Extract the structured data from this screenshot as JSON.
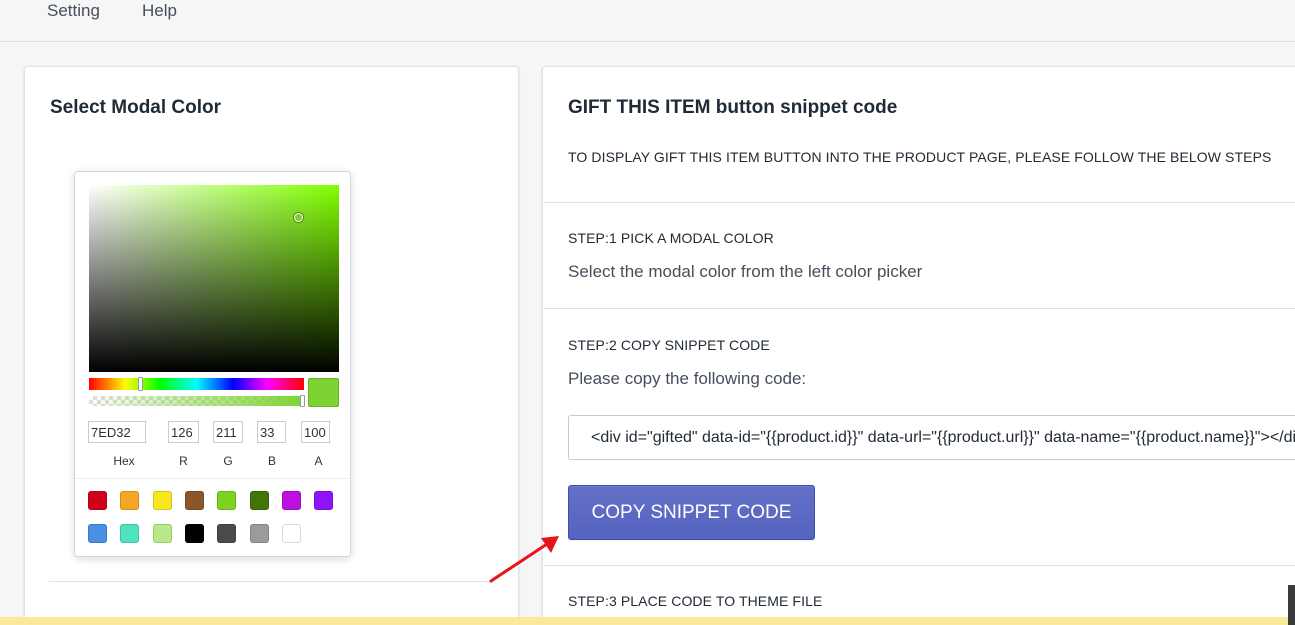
{
  "menu": {
    "items": [
      {
        "label": "Setting"
      },
      {
        "label": "Help"
      }
    ]
  },
  "left_card": {
    "title": "Select Modal Color"
  },
  "color_picker": {
    "current_color": "#7ED332",
    "hue_color": "#80ff00",
    "fields": {
      "hex": {
        "value": "7ED32",
        "label": "Hex"
      },
      "r": {
        "value": "126",
        "label": "R"
      },
      "g": {
        "value": "211",
        "label": "G"
      },
      "b": {
        "value": "33",
        "label": "B"
      },
      "a": {
        "value": "100",
        "label": "A"
      }
    },
    "presets": [
      "#d0021b",
      "#f5a623",
      "#f8e71c",
      "#8b572a",
      "#7ed321",
      "#417505",
      "#bd10e0",
      "#9013fe",
      "#4a90e2",
      "#50e3c2",
      "#b8e986",
      "#000000",
      "#4a4a4a",
      "#9b9b9b",
      "#ffffff"
    ]
  },
  "right_card": {
    "title": "GIFT THIS ITEM button snippet code",
    "subtitle": "TO DISPLAY GIFT THIS ITEM BUTTON INTO THE PRODUCT PAGE, PLEASE FOLLOW THE BELOW STEPS",
    "step1": {
      "heading": "STEP:1 PICK A MODAL COLOR",
      "text": "Select the modal color from the left color picker"
    },
    "step2": {
      "heading": "STEP:2 COPY SNIPPET CODE",
      "text": "Please copy the following code:",
      "code": "<div id=\"gifted\" data-id=\"{{product.id}}\" data-url=\"{{product.url}}\" data-name=\"{{product.name}}\"></div>",
      "button_label": "COPY SNIPPET CODE"
    },
    "step3": {
      "heading": "STEP:3 PLACE CODE TO THEME FILE"
    }
  },
  "annotation": {
    "arrow_color": "#e8141c"
  }
}
